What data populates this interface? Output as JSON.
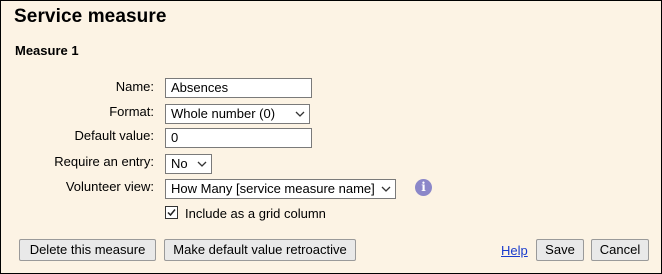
{
  "header": {
    "title": "Service measure",
    "subtitle": "Measure 1"
  },
  "form": {
    "name": {
      "label": "Name:",
      "value": "Absences"
    },
    "format": {
      "label": "Format:",
      "value": "Whole number (0)"
    },
    "default_value": {
      "label": "Default value:",
      "value": "0"
    },
    "require_entry": {
      "label": "Require an entry:",
      "value": "No"
    },
    "volunteer_view": {
      "label": "Volunteer view:",
      "value": "How Many [service measure name]",
      "info_icon": "info-icon"
    },
    "grid_column": {
      "label": "Include as a grid column",
      "checked": true
    }
  },
  "buttons": {
    "delete": "Delete this measure",
    "retroactive": "Make default value retroactive",
    "help": "Help",
    "save": "Save",
    "cancel": "Cancel"
  },
  "colors": {
    "panel_background": "#fcf3e4",
    "info_icon": "#8b87c9",
    "link": "#1a3ccc"
  }
}
